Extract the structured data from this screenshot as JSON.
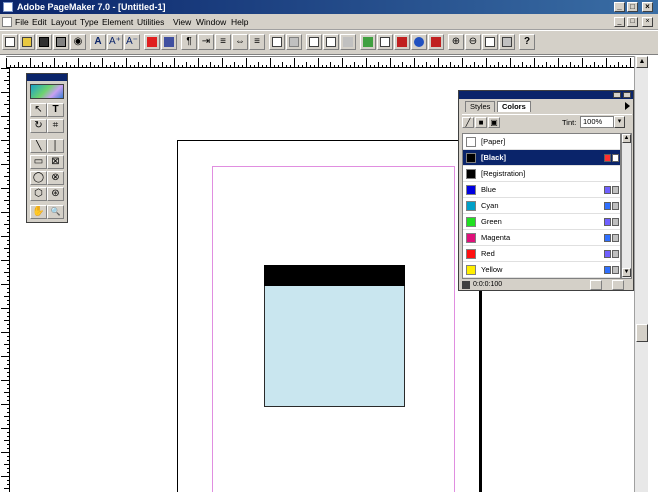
{
  "window": {
    "title": "Adobe PageMaker 7.0 - [Untitled-1]",
    "minimize": "_",
    "restore": "□",
    "close": "×"
  },
  "menubar": {
    "items": [
      "File",
      "Edit",
      "Layout",
      "Type",
      "Element",
      "Utilities",
      "View",
      "Window",
      "Help"
    ],
    "doc_minimize": "_",
    "doc_restore": "□",
    "doc_close": "×"
  },
  "toolbar": {
    "icons": [
      "new-icon",
      "open-icon",
      "save-icon",
      "print-icon",
      "find-icon",
      "font-icon",
      "font-bigger-icon",
      "font-smaller-icon",
      "spell-icon",
      "story-icon",
      "paragraph-icon",
      "indent-icon",
      "align-icon",
      "tab-icon",
      "style-icon",
      "copy-icon",
      "paste-icon",
      "place-icon",
      "hyperlink-icon",
      "link-icon",
      "convert-icon",
      "export-icon",
      "pdf-icon",
      "globe-icon",
      "acrobat-icon",
      "zoom-in-icon",
      "zoom-out-icon",
      "pages-icon",
      "layers-icon",
      "help-icon"
    ],
    "text_labels": {
      "font": "A",
      "bigger": "A⁺",
      "smaller": "A⁻",
      "help": "?"
    }
  },
  "toolbox": {
    "tools": [
      {
        "name": "pointer-tool",
        "glyph": "↖"
      },
      {
        "name": "text-tool",
        "glyph": "T"
      },
      {
        "name": "rotate-tool",
        "glyph": "↻"
      },
      {
        "name": "crop-tool",
        "glyph": "⌗"
      },
      {
        "name": "line-tool",
        "glyph": "╲"
      },
      {
        "name": "constrained-line-tool",
        "glyph": "│"
      },
      {
        "name": "rectangle-tool",
        "glyph": "▭"
      },
      {
        "name": "rectangle-frame-tool",
        "glyph": "⊠"
      },
      {
        "name": "ellipse-tool",
        "glyph": "◯"
      },
      {
        "name": "ellipse-frame-tool",
        "glyph": "⊗"
      },
      {
        "name": "polygon-tool",
        "glyph": "⬡"
      },
      {
        "name": "polygon-frame-tool",
        "glyph": "⊛"
      },
      {
        "name": "hand-tool",
        "glyph": "✋"
      },
      {
        "name": "zoom-tool",
        "glyph": "🔍"
      }
    ]
  },
  "colors_palette": {
    "tabs": [
      "Styles",
      "Colors"
    ],
    "active_tab": "Colors",
    "tint_label": "Tint:",
    "tint_value": "100%",
    "tint_dropdown": "▾",
    "rows": [
      {
        "label": "[Paper]",
        "swatch": "#ffffff",
        "selected": false,
        "icons": []
      },
      {
        "label": "[Black]",
        "swatch": "#000000",
        "selected": true,
        "icons": [
          "#ff3030",
          "#ffffff"
        ]
      },
      {
        "label": "[Registration]",
        "swatch": "#000000",
        "selected": false,
        "icons": []
      },
      {
        "label": "Blue",
        "swatch": "#0000e0",
        "selected": false,
        "icons": [
          "#7060ff",
          "#c0c0c0"
        ]
      },
      {
        "label": "Cyan",
        "swatch": "#00a0c8",
        "selected": false,
        "icons": [
          "#3070ff",
          "#c0c0c0"
        ]
      },
      {
        "label": "Green",
        "swatch": "#20e020",
        "selected": false,
        "icons": [
          "#7060ff",
          "#c0c0c0"
        ]
      },
      {
        "label": "Magenta",
        "swatch": "#e0107a",
        "selected": false,
        "icons": [
          "#3070ff",
          "#c0c0c0"
        ]
      },
      {
        "label": "Red",
        "swatch": "#ff1010",
        "selected": false,
        "icons": [
          "#7060ff",
          "#c0c0c0"
        ]
      },
      {
        "label": "Yellow",
        "swatch": "#ffee00",
        "selected": false,
        "icons": [
          "#3070ff",
          "#c0c0c0"
        ]
      }
    ],
    "status": "0:0:0:100"
  },
  "colors": {
    "title_bar": "#0a246a",
    "chrome": "#d4d0c8",
    "margin_guide": "#e08ee0",
    "box_black": "#000000",
    "box_fill": "#c9e6ef"
  }
}
